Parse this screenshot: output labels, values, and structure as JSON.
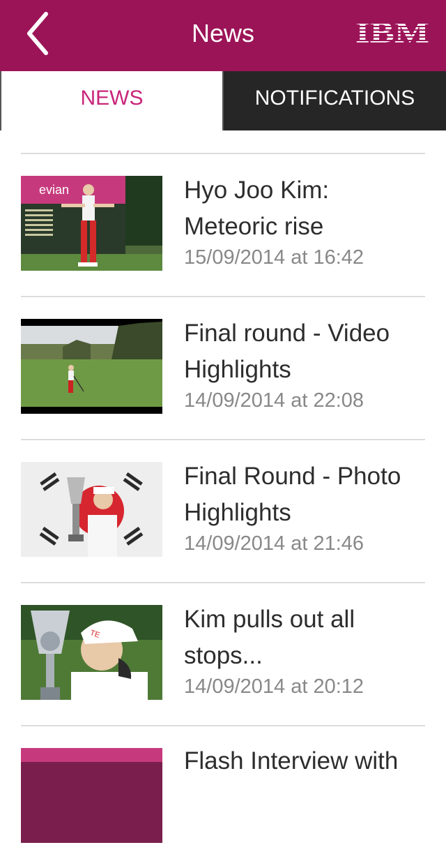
{
  "header": {
    "title": "News",
    "back_icon": "chevron-left-icon",
    "logo_text": "IBM",
    "background_color": "#9c1458"
  },
  "tabs": [
    {
      "label": "NEWS",
      "active": true,
      "color": "#c8257a"
    },
    {
      "label": "NOTIFICATIONS",
      "active": false,
      "color": "#262626"
    }
  ],
  "news": [
    {
      "headline": "Hyo Joo Kim: Meteoric rise",
      "timestamp": "15/09/2014 at 16:42"
    },
    {
      "headline": "Final round - Video Highlights",
      "timestamp": "14/09/2014 at 22:08"
    },
    {
      "headline": "Final Round - Photo Highlights",
      "timestamp": "14/09/2014 at 21:46"
    },
    {
      "headline": "Kim pulls out all stops...",
      "timestamp": "14/09/2014 at 20:12"
    },
    {
      "headline": "Flash Interview with",
      "timestamp": ""
    }
  ]
}
